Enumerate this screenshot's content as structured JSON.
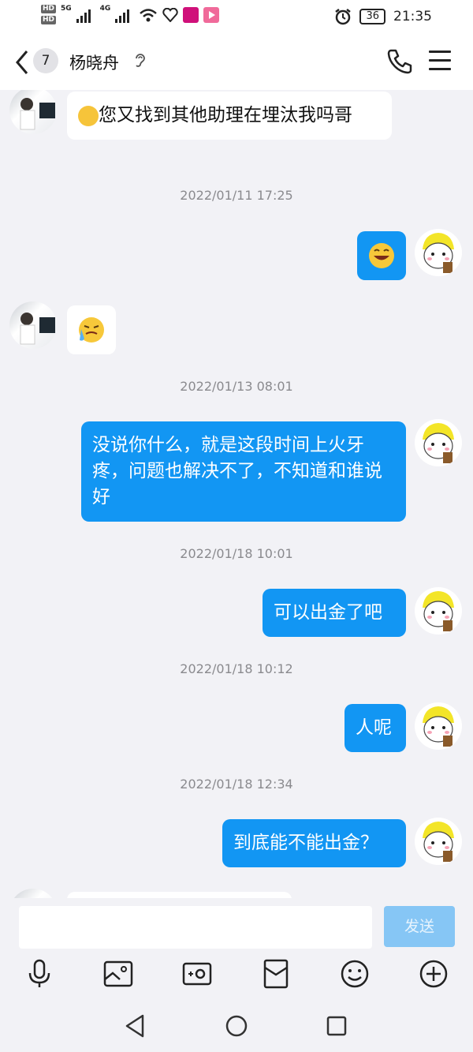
{
  "status_bar": {
    "hd1": "HD",
    "hd2": "HD",
    "net1": "5G",
    "net2": "4G",
    "battery": "36",
    "time": "21:35"
  },
  "header": {
    "unread_count": "7",
    "contact_name": "杨晓舟"
  },
  "messages": [
    {
      "type": "in",
      "text": "您又找到其他助理在埋汰我吗哥"
    },
    {
      "type": "time",
      "text": "2022/01/11 17:25"
    },
    {
      "type": "out",
      "emoji": "grinning-face"
    },
    {
      "type": "in",
      "emoji": "crying-face"
    },
    {
      "type": "time",
      "text": "2022/01/13 08:01"
    },
    {
      "type": "out",
      "text": "没说你什么，就是这段时间上火牙疼，问题也解决不了，不知道和谁说好"
    },
    {
      "type": "time",
      "text": "2022/01/18 10:01"
    },
    {
      "type": "out",
      "text": "可以出金了吧"
    },
    {
      "type": "time",
      "text": "2022/01/18 10:12"
    },
    {
      "type": "out",
      "text": "人呢"
    },
    {
      "type": "time",
      "text": "2022/01/18 12:34"
    },
    {
      "type": "out",
      "text": "到底能不能出金？"
    }
  ],
  "composer": {
    "input_value": "",
    "send_label": "发送"
  },
  "colors": {
    "outgoing_bubble": "#1296f3",
    "incoming_bubble": "#ffffff",
    "background": "#f2f2f6",
    "send_disabled": "#86c6f5"
  }
}
